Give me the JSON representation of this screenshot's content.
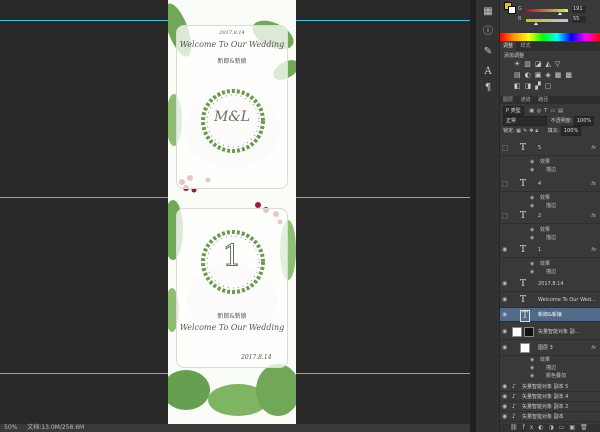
{
  "status": {
    "zoom": "50%",
    "doc_info": "文档:13.0M/258.6M"
  },
  "colors": {
    "accent_guide": "#38c6dd",
    "panel_bg": "#393939",
    "selected_layer": "#526a8a"
  },
  "color_panel": {
    "g_label": "G",
    "g_value": "191",
    "b_label": "B",
    "b_value": "55",
    "g_fraction": 0.75,
    "b_fraction": 0.22
  },
  "adjust_panel": {
    "tabs": [
      "调整",
      "样式"
    ],
    "title": "添加调整"
  },
  "layers_panel": {
    "tabs": [
      "图层",
      "通道",
      "路径"
    ],
    "filter_label": "P 类型",
    "blend_mode": "正常",
    "opacity_label": "不透明度:",
    "opacity_value": "100%",
    "lock_label": "锁定:",
    "fill_label": "填充:",
    "fill_value": "100%",
    "layers": [
      {
        "name": "5",
        "type": "text",
        "fx": "fx",
        "visible": false
      },
      {
        "name": "4",
        "type": "text",
        "fx": "fx",
        "visible": false
      },
      {
        "name": "2",
        "type": "text",
        "fx": "fx",
        "visible": false
      },
      {
        "name": "1",
        "type": "text",
        "fx": "fx",
        "visible": true
      },
      {
        "name": "2017.8.14",
        "type": "text",
        "fx": "",
        "visible": true
      },
      {
        "name": "Welcome To Our Wed...",
        "type": "text",
        "fx": "",
        "visible": true
      },
      {
        "name": "新郎&新娘",
        "type": "text",
        "fx": "",
        "visible": true,
        "selected": true
      },
      {
        "name": "矢量智能对象 副...",
        "type": "smart",
        "fx": "",
        "visible": true
      },
      {
        "name": "图层 3",
        "type": "pixel",
        "fx": "fx",
        "visible": true
      },
      {
        "name": "矢量智能对象 副本 5",
        "type": "smart",
        "fx": "",
        "visible": true
      },
      {
        "name": "矢量智能对象 副本 4",
        "type": "smart",
        "fx": "",
        "visible": true
      },
      {
        "name": "矢量智能对象 副本 2",
        "type": "smart",
        "fx": "",
        "visible": true
      },
      {
        "name": "矢量智能对象 副本",
        "type": "smart",
        "fx": "",
        "visible": true
      }
    ],
    "effects_label": "效果",
    "effect_stroke": "描边",
    "effect_color_overlay": "颜色叠加"
  },
  "document": {
    "top_card_script": "Welcome To Our Wedding",
    "top_card_names": "新郎&新娘",
    "top_card_monogram": "M&L",
    "top_card_date": "2017.8.14",
    "bottom_card_number": "1",
    "bottom_card_names": "新郎&新娘",
    "bottom_card_script": "Welcome To Our Wedding",
    "bottom_card_date": "2017.8.14"
  }
}
